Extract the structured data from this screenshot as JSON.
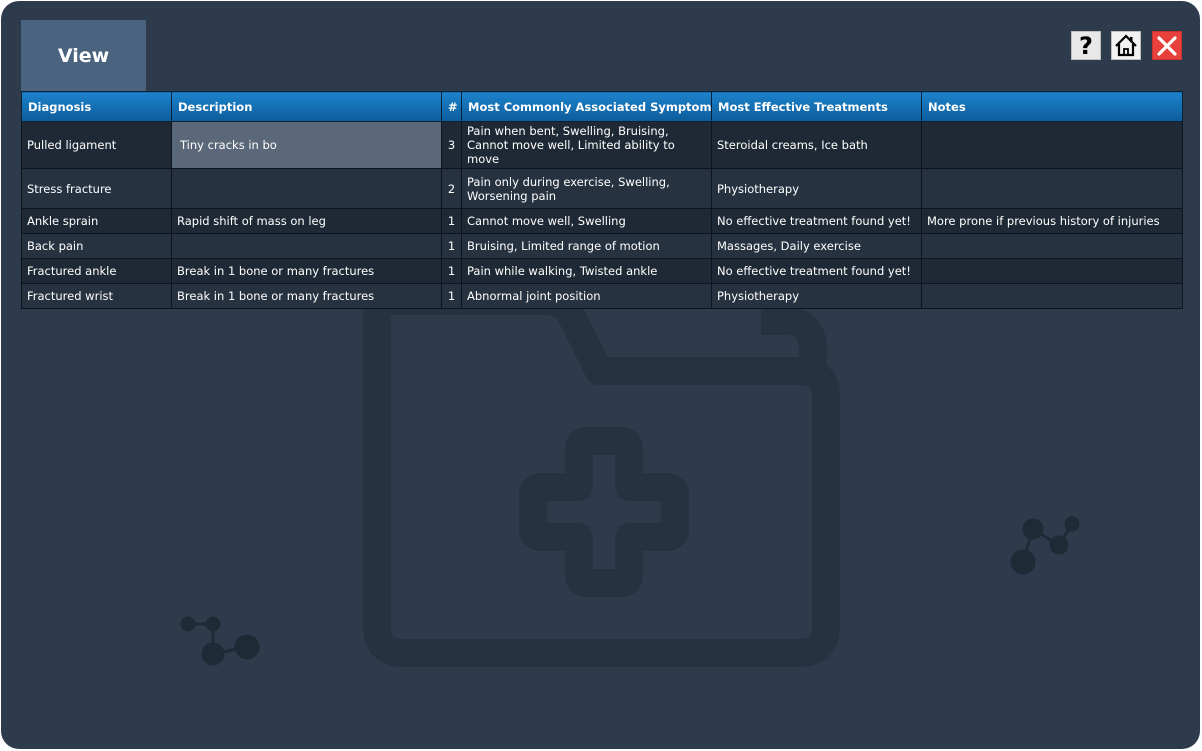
{
  "title": "View",
  "toolbar": {
    "help_icon": "question-mark-icon",
    "home_icon": "home-icon",
    "close_icon": "close-x-icon",
    "close_color": "#e8403b"
  },
  "table": {
    "columns": [
      "Diagnosis",
      "Description",
      "#",
      "Most Commonly Associated Symptoms",
      "Most Effective Treatments",
      "Notes"
    ],
    "rows": [
      [
        "Pulled ligament",
        "Tiny cracks in bo",
        "3",
        "Pain when bent, Swelling, Bruising, Cannot move well, Limited ability to move",
        "Steroidal creams, Ice bath",
        ""
      ],
      [
        "Stress fracture",
        "",
        "2",
        "Pain only during exercise, Swelling, Worsening pain",
        "Physiotherapy",
        ""
      ],
      [
        "Ankle sprain",
        "Rapid shift of mass on leg",
        "1",
        "Cannot move well, Swelling",
        "No effective treatment found yet!",
        "More prone if previous history of injuries"
      ],
      [
        "Back pain",
        "",
        "1",
        "Bruising, Limited range of motion",
        "Massages, Daily exercise",
        ""
      ],
      [
        "Fractured ankle",
        "Break in 1 bone or many fractures",
        "1",
        "Pain while walking, Twisted ankle",
        "No effective treatment found yet!",
        ""
      ],
      [
        "Fractured wrist",
        "Break in 1 bone or many fractures",
        "1",
        "Abnormal joint position",
        "Physiotherapy",
        ""
      ]
    ]
  },
  "theme": {
    "background": "#2d3b4c",
    "header": "#1976bd",
    "tab": "#4a6480"
  }
}
